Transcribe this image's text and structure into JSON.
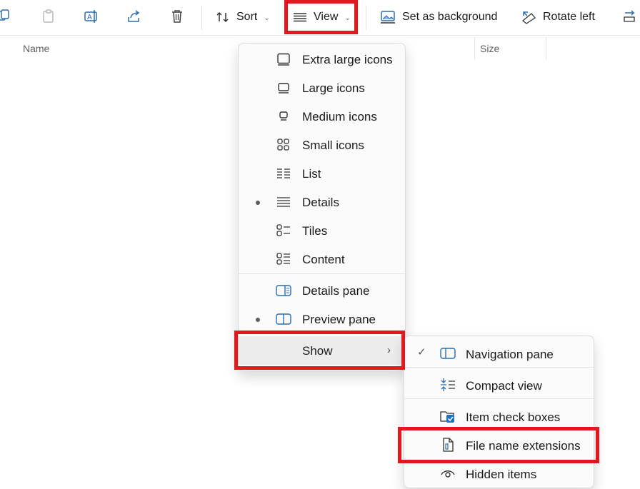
{
  "toolbar": {
    "sort_label": "Sort",
    "view_label": "View",
    "set_background_label": "Set as background",
    "rotate_left_label": "Rotate left"
  },
  "columns": {
    "name": "Name",
    "size": "Size"
  },
  "view_menu": {
    "items": [
      {
        "label": "Extra large icons",
        "icon": "extra-large-icons-icon",
        "selected": false
      },
      {
        "label": "Large icons",
        "icon": "large-icons-icon",
        "selected": false
      },
      {
        "label": "Medium icons",
        "icon": "medium-icons-icon",
        "selected": false
      },
      {
        "label": "Small icons",
        "icon": "small-icons-icon",
        "selected": false
      },
      {
        "label": "List",
        "icon": "list-icon",
        "selected": false
      },
      {
        "label": "Details",
        "icon": "details-icon",
        "selected": true
      },
      {
        "label": "Tiles",
        "icon": "tiles-icon",
        "selected": false
      },
      {
        "label": "Content",
        "icon": "content-icon",
        "selected": false
      }
    ],
    "panes": [
      {
        "label": "Details pane",
        "icon": "details-pane-icon",
        "selected": false
      },
      {
        "label": "Preview pane",
        "icon": "preview-pane-icon",
        "selected": true
      }
    ],
    "show_label": "Show"
  },
  "show_menu": {
    "items": [
      {
        "label": "Navigation pane",
        "icon": "navigation-pane-icon",
        "checked": true
      },
      {
        "label": "Compact view",
        "icon": "compact-view-icon",
        "checked": false
      },
      {
        "label": "Item check boxes",
        "icon": "item-check-boxes-icon",
        "checked": false
      },
      {
        "label": "File name extensions",
        "icon": "file-name-extensions-icon",
        "checked": false
      },
      {
        "label": "Hidden items",
        "icon": "hidden-items-icon",
        "checked": false
      }
    ]
  },
  "colors": {
    "highlight": "#e0191f",
    "accent": "#1a73c7"
  }
}
